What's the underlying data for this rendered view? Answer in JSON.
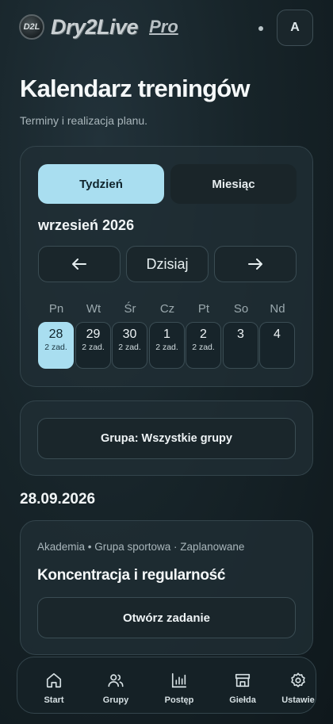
{
  "header": {
    "logo": {
      "emblem": "D2L",
      "brand": "Dry2Live",
      "suffix": "Pro"
    },
    "avatar_initial": "A"
  },
  "page": {
    "title": "Kalendarz treningów",
    "subtitle": "Terminy i realizacja planu."
  },
  "calendar": {
    "tabs": [
      {
        "label": "Tydzień",
        "active": true
      },
      {
        "label": "Miesiąc",
        "active": false
      }
    ],
    "month_label": "wrzesień 2026",
    "nav": {
      "prev_icon": "arrow-left-icon",
      "today_label": "Dzisiaj",
      "next_icon": "arrow-right-icon"
    },
    "weekdays": [
      "Pn",
      "Wt",
      "Śr",
      "Cz",
      "Pt",
      "So",
      "Nd"
    ],
    "days": [
      {
        "num": "28",
        "tasks": "2 zad.",
        "selected": true
      },
      {
        "num": "29",
        "tasks": "2 zad.",
        "selected": false
      },
      {
        "num": "30",
        "tasks": "2 zad.",
        "selected": false
      },
      {
        "num": "1",
        "tasks": "2 zad.",
        "selected": false
      },
      {
        "num": "2",
        "tasks": "2 zad.",
        "selected": false
      },
      {
        "num": "3",
        "tasks": "",
        "selected": false
      },
      {
        "num": "4",
        "tasks": "",
        "selected": false
      }
    ]
  },
  "filter": {
    "group_label": "Grupa: Wszystkie grupy"
  },
  "selected_date": "28.09.2026",
  "task": {
    "meta": "Akademia • Grupa sportowa · Zaplanowane",
    "title": "Koncentracja i regularność",
    "open_label": "Otwórz zadanie"
  },
  "bottom_nav": [
    {
      "label": "Start",
      "icon": "home-icon"
    },
    {
      "label": "Grupy",
      "icon": "users-icon"
    },
    {
      "label": "Postęp",
      "icon": "bar-chart-icon"
    },
    {
      "label": "Giełda",
      "icon": "store-icon"
    },
    {
      "label": "Ustawie",
      "icon": "settings-icon"
    }
  ],
  "colors": {
    "accent": "#a9def0",
    "background": "#172429",
    "card": "#202e34"
  }
}
